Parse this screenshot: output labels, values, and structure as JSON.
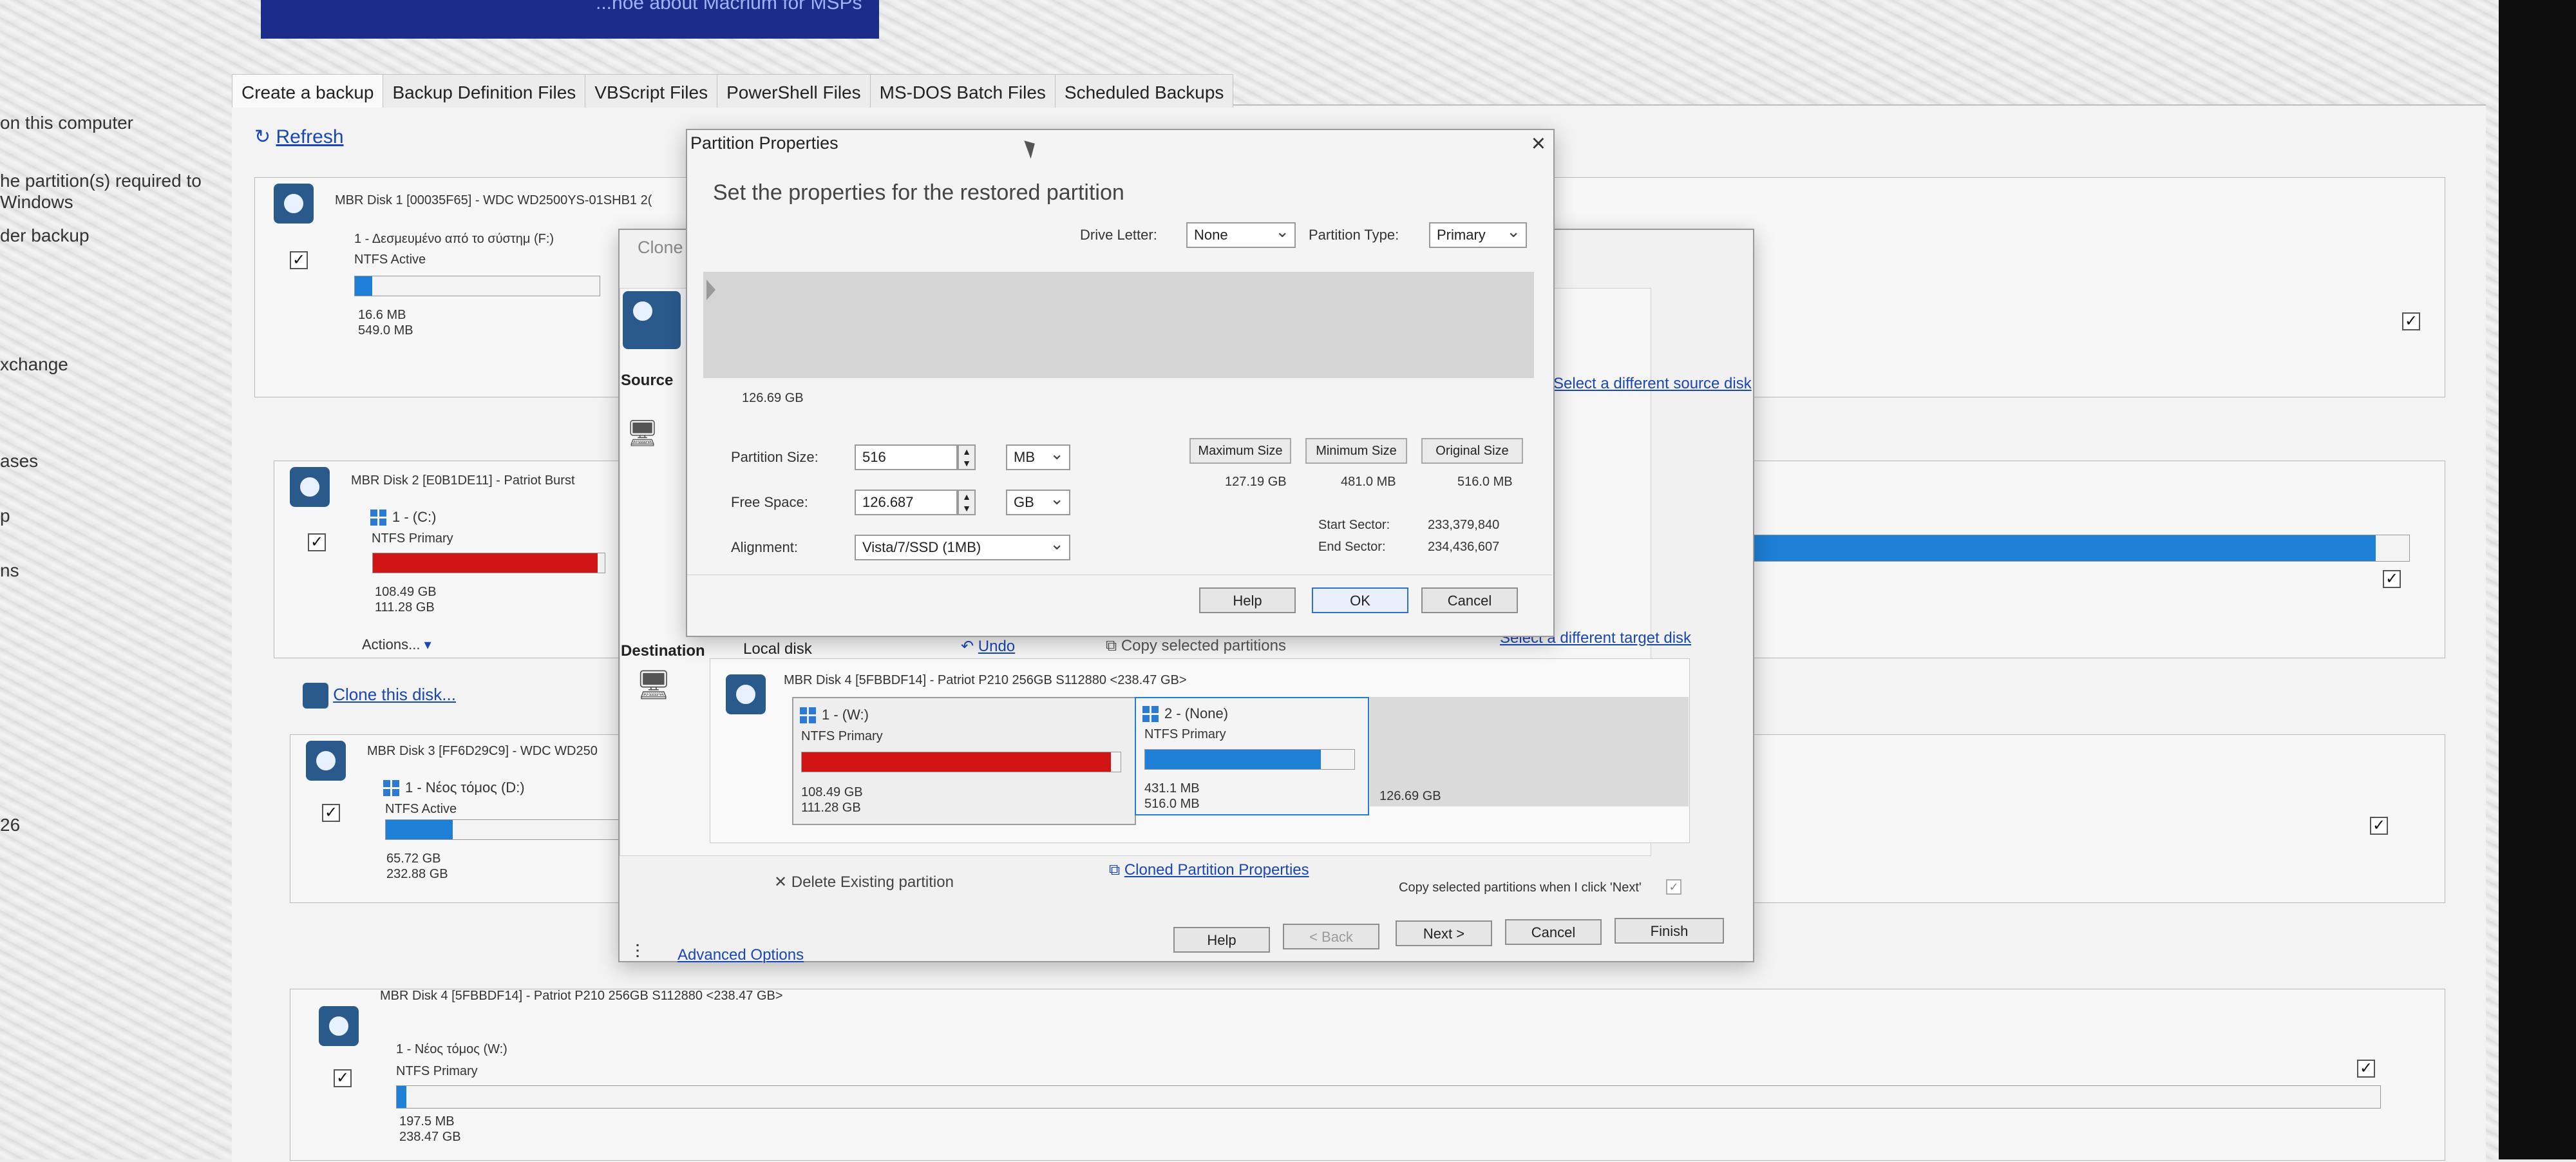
{
  "banner": {
    "text": "...hoe about Macrium for MSPs"
  },
  "sidebar": {
    "items": [
      "on this computer",
      "he partition(s) required to",
      "Windows",
      "der backup",
      "xchange",
      "ases",
      "p",
      "ns",
      "26"
    ]
  },
  "tabs": [
    {
      "label": "Create a backup"
    },
    {
      "label": "Backup Definition Files"
    },
    {
      "label": "VBScript Files"
    },
    {
      "label": "PowerShell Files"
    },
    {
      "label": "MS-DOS Batch Files"
    },
    {
      "label": "Scheduled Backups"
    }
  ],
  "main": {
    "refresh": "Refresh",
    "disk1": {
      "title": "MBR Disk 1 [00035F65] - WDC WD2500YS-01SHB1 2(",
      "part_label": "1 - Δεσμευμένο από το σύστημ (F:)",
      "fs": "NTFS Active",
      "used": "16.6 MB",
      "total": "549.0 MB",
      "fill": 0.07
    },
    "disk2": {
      "title": "MBR Disk 2 [E0B1DE11] - Patriot Burst",
      "part_label": "1 - (C:)",
      "fs": "NTFS Primary",
      "used": "108.49 GB",
      "total": "111.28 GB",
      "fill": 0.97,
      "actions": "Actions..."
    },
    "clone_link": "Clone this disk...",
    "disk3": {
      "title": "MBR Disk 3 [FF6D29C9] - WDC WD250",
      "part_label": "1 - Νέος τόμος (D:)",
      "fs": "NTFS Active",
      "used": "65.72 GB",
      "total": "232.88 GB",
      "fill": 0.28
    },
    "disk4": {
      "title": "MBR Disk 4 [5FBBDF14] - Patriot P210 256GB S112880 <238.47 GB>",
      "part_label": "1 - Νέος τόμος (W:)",
      "fs": "NTFS Primary",
      "used": "197.5 MB",
      "total": "238.47 GB",
      "fill": 0.001
    }
  },
  "clone": {
    "title": "Clone",
    "source_label": "Source",
    "select_source": "Select a different source disk",
    "destination_label": "Destination",
    "local_disk": "Local disk",
    "undo": "Undo",
    "copy_partitions": "Copy selected partitions",
    "select_target": "Select a different target disk",
    "target_disk_title": "MBR Disk 4 [5FBBDF14] - Patriot P210 256GB S112880 <238.47 GB>",
    "part1": {
      "label": "1 - (W:)",
      "fs": "NTFS Primary",
      "used": "108.49 GB",
      "total": "111.28 GB",
      "fill": 0.97
    },
    "part2": {
      "label": "2 - (None)",
      "fs": "NTFS Primary",
      "used": "431.1 MB",
      "total": "516.0 MB",
      "fill": 0.84
    },
    "unallocated": "126.69 GB",
    "delete_existing": "Delete Existing partition",
    "cloned_props": "Cloned Partition Properties",
    "copy_on_next": "Copy selected partitions when I click 'Next'",
    "advanced": "Advanced Options",
    "buttons": {
      "help": "Help",
      "back": "< Back",
      "next": "Next >",
      "cancel": "Cancel",
      "finish": "Finish"
    }
  },
  "props": {
    "title": "Partition Properties",
    "heading": "Set the properties for the restored partition",
    "drive_letter_label": "Drive Letter:",
    "drive_letter_value": "None",
    "partition_type_label": "Partition Type:",
    "partition_type_value": "Primary",
    "map_free": "126.69 GB",
    "partition_size_label": "Partition Size:",
    "partition_size_value": "516",
    "partition_size_unit": "MB",
    "free_space_label": "Free Space:",
    "free_space_value": "126.687",
    "free_space_unit": "GB",
    "alignment_label": "Alignment:",
    "alignment_value": "Vista/7/SSD (1MB)",
    "max_size_btn": "Maximum Size",
    "max_size_val": "127.19 GB",
    "min_size_btn": "Minimum Size",
    "min_size_val": "481.0 MB",
    "orig_size_btn": "Original Size",
    "orig_size_val": "516.0 MB",
    "start_sector_label": "Start Sector:",
    "start_sector_val": "233,379,840",
    "end_sector_label": "End Sector:",
    "end_sector_val": "234,436,607",
    "help": "Help",
    "ok": "OK",
    "cancel": "Cancel"
  }
}
